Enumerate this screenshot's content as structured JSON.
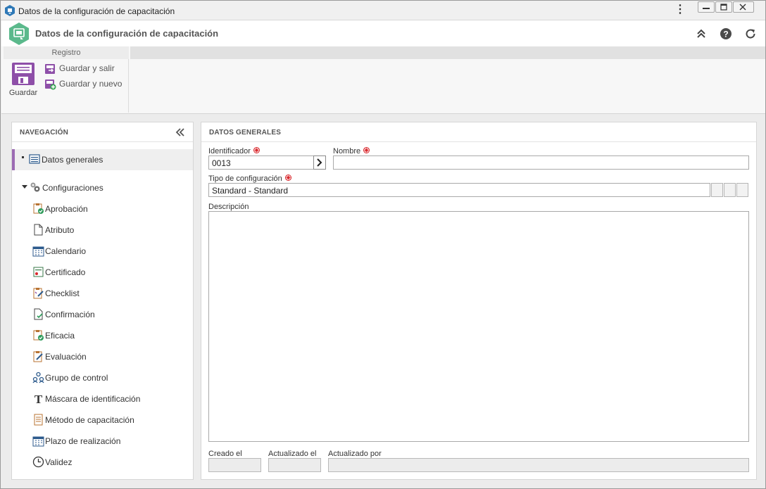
{
  "window": {
    "title": "Datos de la configuración de capacitación"
  },
  "header": {
    "title": "Datos de la configuración de capacitación"
  },
  "ribbon": {
    "group_label": "Registro",
    "save_label": "Guardar",
    "save_and_exit_label": "Guardar y salir",
    "save_and_new_label": "Guardar y nuevo"
  },
  "navigation": {
    "title": "NAVEGACIÓN",
    "general_data": "Datos generales",
    "configurations": "Configuraciones",
    "items": [
      {
        "label": "Aprobación",
        "icon": "approval-icon"
      },
      {
        "label": "Atributo",
        "icon": "attribute-icon"
      },
      {
        "label": "Calendario",
        "icon": "calendar-icon"
      },
      {
        "label": "Certificado",
        "icon": "certificate-icon"
      },
      {
        "label": "Checklist",
        "icon": "checklist-icon"
      },
      {
        "label": "Confirmación",
        "icon": "confirmation-icon"
      },
      {
        "label": "Eficacia",
        "icon": "efficacy-icon"
      },
      {
        "label": "Evaluación",
        "icon": "evaluation-icon"
      },
      {
        "label": "Grupo de control",
        "icon": "group-icon"
      },
      {
        "label": "Máscara de identificación",
        "icon": "text-mask-icon"
      },
      {
        "label": "Método de capacitación",
        "icon": "method-icon"
      },
      {
        "label": "Plazo de realización",
        "icon": "deadline-icon"
      },
      {
        "label": "Validez",
        "icon": "clock-icon"
      }
    ]
  },
  "form": {
    "section_title": "DATOS GENERALES",
    "identifier_label": "Identificador",
    "identifier_value": "0013",
    "name_label": "Nombre",
    "name_value": "",
    "config_type_label": "Tipo de configuración",
    "config_type_value": "Standard - Standard",
    "description_label": "Descripción",
    "created_label": "Creado el",
    "updated_label": "Actualizado el",
    "updated_by_label": "Actualizado por"
  },
  "colors": {
    "accent_purple": "#9c6bb3",
    "brand_green": "#5bb98c",
    "required_red": "#d9262b"
  }
}
